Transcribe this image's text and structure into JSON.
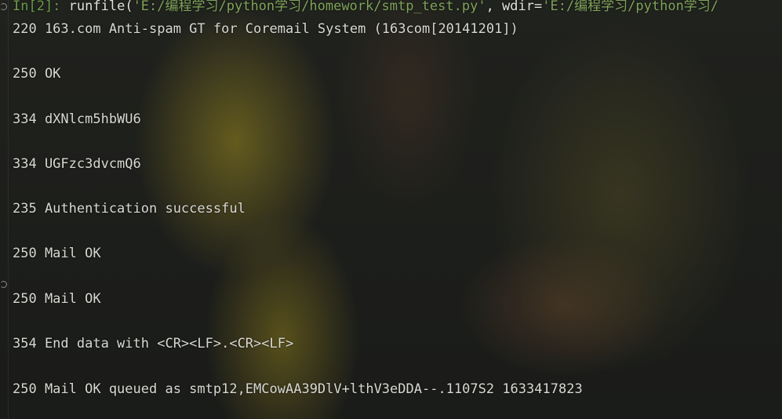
{
  "console": {
    "prompt": "In[2]:",
    "command": {
      "func": "runfile(",
      "arg1": "'E:/编程学习/python学习/homework/smtp_test.py'",
      "sep": ", wdir=",
      "arg2": "'E:/编程学习/python学习/"
    },
    "output_lines": [
      "220 163.com Anti-spam GT for Coremail System (163com[20141201])",
      "250 OK",
      "334 dXNlcm5hbWU6",
      "334 UGFzc3dvcmQ6",
      "235 Authentication successful",
      "250 Mail OK",
      "250 Mail OK",
      "354 End data with <CR><LF>.<CR><LF>",
      "250 Mail OK queued as smtp12,EMCowAA39DlV+lthV3eDDA--.1107S2 1633417823"
    ]
  },
  "theme": {
    "prompt_color": "#6a9b48",
    "string_color": "#7fa35a",
    "text_color": "#d8d8d3",
    "background": "#222421"
  }
}
